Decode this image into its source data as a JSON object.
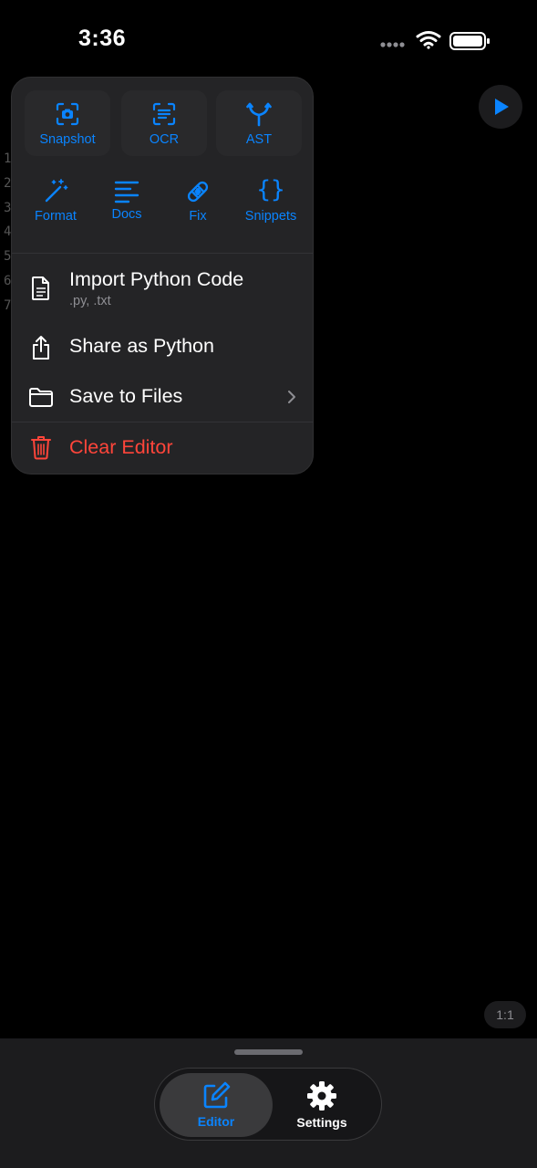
{
  "status": {
    "time": "3:36"
  },
  "gutter": {
    "lines": [
      "1",
      "2",
      "3",
      "4",
      "5",
      "6",
      "7"
    ]
  },
  "toolbar_grid": {
    "row1": [
      {
        "label": "Snapshot",
        "icon": "camera-viewfinder-icon"
      },
      {
        "label": "OCR",
        "icon": "text-viewfinder-icon"
      },
      {
        "label": "AST",
        "icon": "branch-icon"
      }
    ],
    "row2": [
      {
        "label": "Format",
        "icon": "magic-wand-icon"
      },
      {
        "label": "Docs",
        "icon": "text-align-left-icon"
      },
      {
        "label": "Fix",
        "icon": "bandage-icon"
      },
      {
        "label": "Snippets",
        "icon": "curly-braces-icon"
      }
    ]
  },
  "menu": {
    "import": {
      "label": "Import Python Code",
      "sub": ".py, .txt"
    },
    "share": {
      "label": "Share as Python"
    },
    "save": {
      "label": "Save to Files"
    },
    "clear": {
      "label": "Clear Editor"
    }
  },
  "editor": {
    "cursor_position": "1:1"
  },
  "tabs": [
    {
      "label": "Editor",
      "icon": "square-pencil-icon"
    },
    {
      "label": "Settings",
      "icon": "gear-icon"
    }
  ],
  "colors": {
    "accent": "#0a84ff",
    "danger": "#ff453a",
    "background": "#000000",
    "menu_bg": "#242426"
  }
}
